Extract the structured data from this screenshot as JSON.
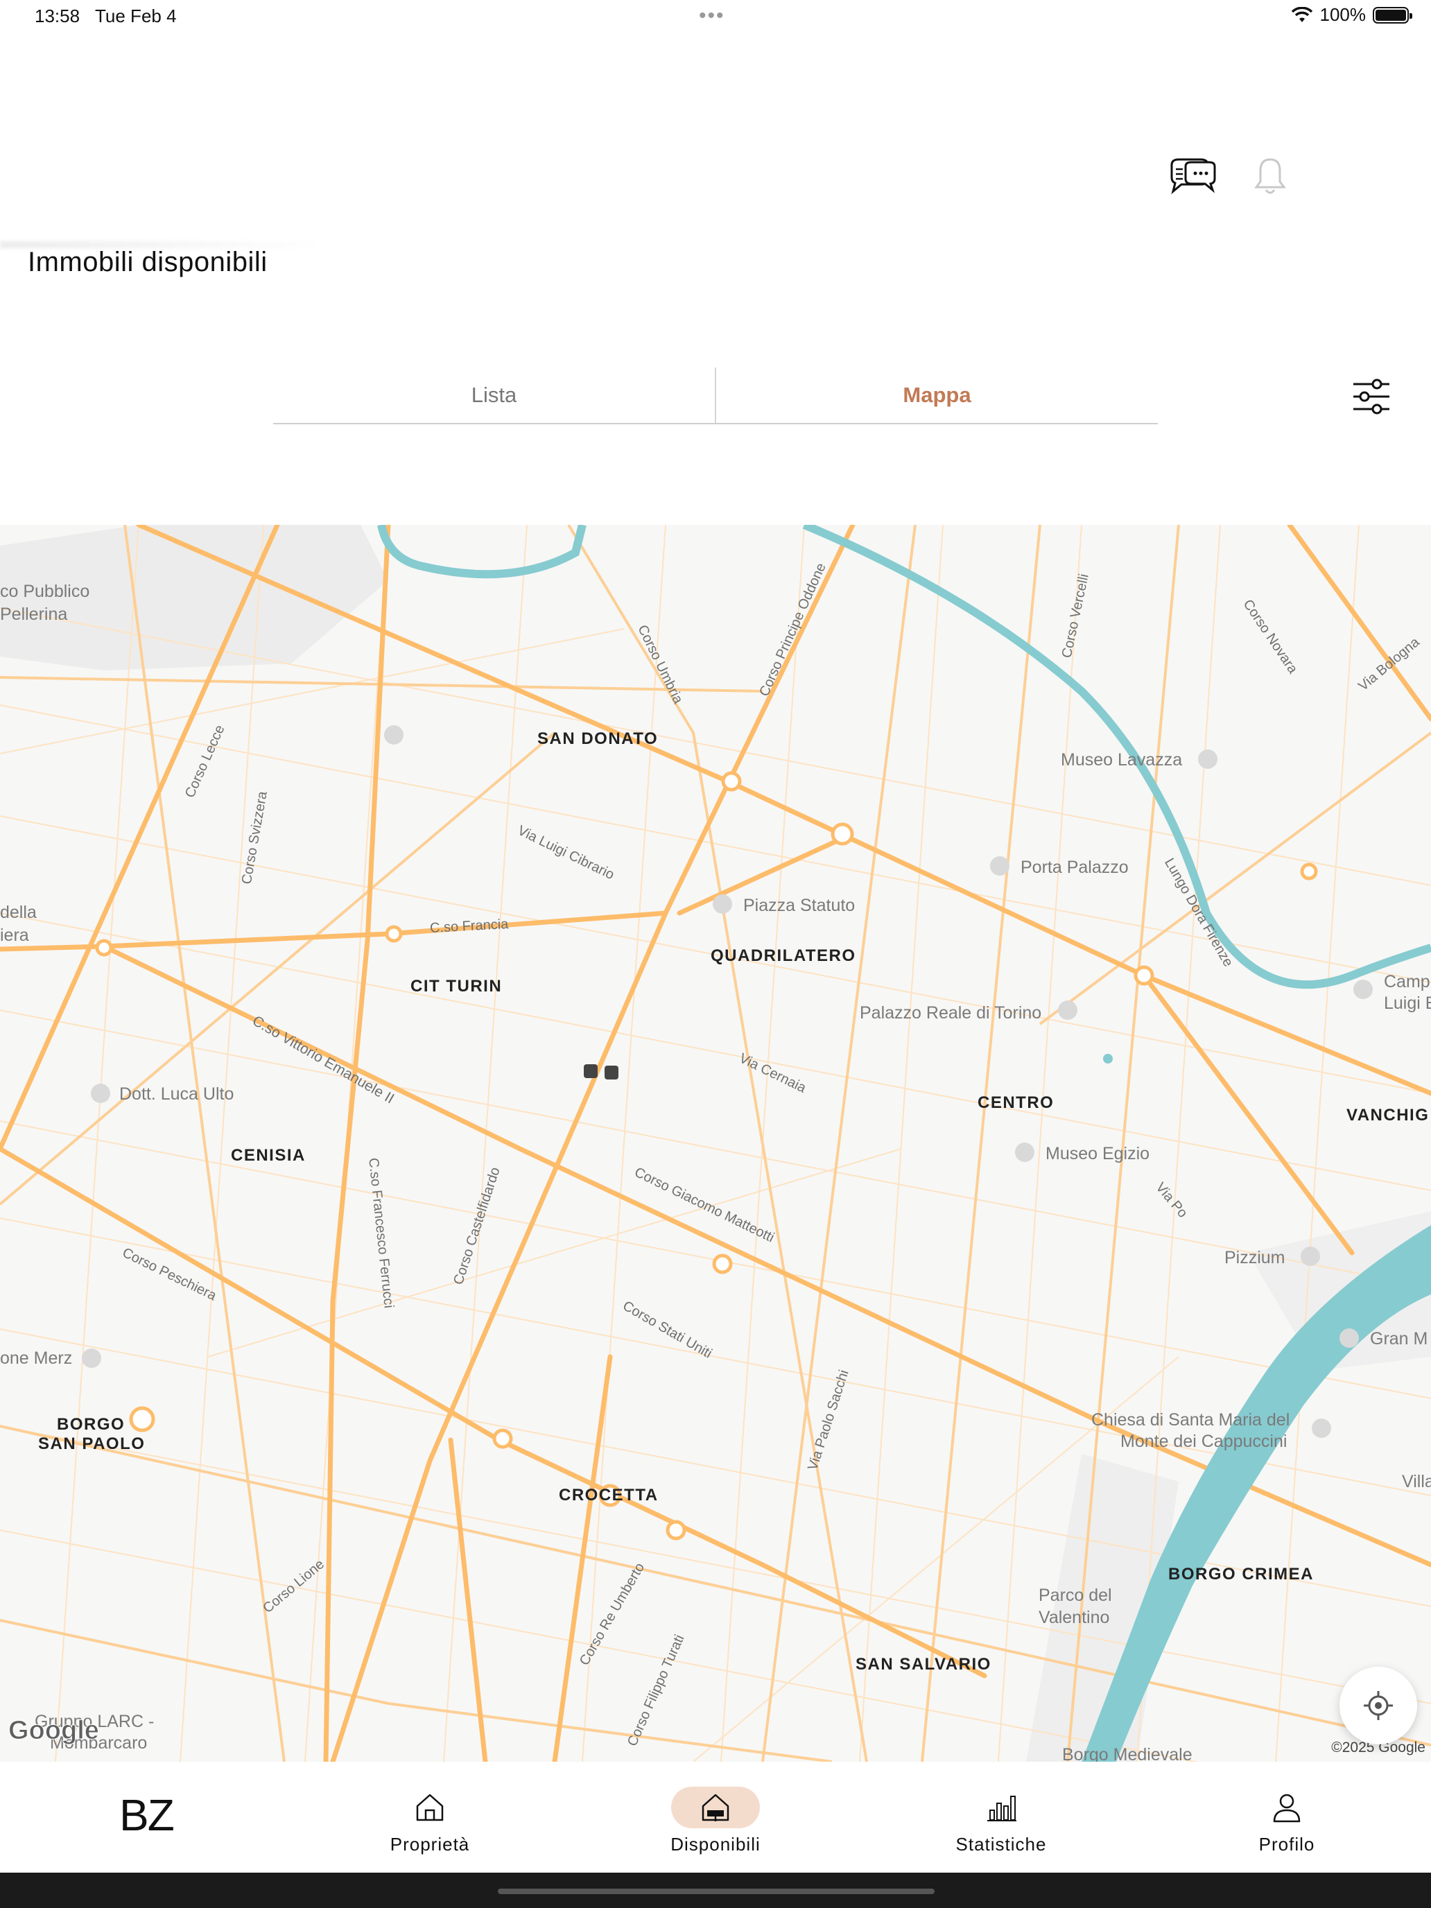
{
  "status_bar": {
    "time": "13:58",
    "date": "Tue Feb 4",
    "battery": "100%"
  },
  "header": {
    "title": "Immobili disponibili"
  },
  "segmented": {
    "lista": "Lista",
    "mappa": "Mappa",
    "selected": "Mappa"
  },
  "map": {
    "labels": {
      "san_donato": "SAN DONATO",
      "quadrilatero": "QUADRILATERO",
      "cit_turin": "CIT TURIN",
      "centro": "CENTRO",
      "vanchiglia": "VANCHIG",
      "cenisia": "CENISIA",
      "borgo_san_paolo_1": "BORGO",
      "borgo_san_paolo_2": "SAN PAOLO",
      "crocetta": "CROCETTA",
      "san_salvario": "SAN SALVARIO",
      "borgo_crimea": "BORGO CRIMEA",
      "parco_pellerina_1": "co Pubblico",
      "parco_pellerina_2": "Pellerina",
      "museo_lavazza": "Museo Lavazza",
      "porta_palazzo": "Porta Palazzo",
      "piazza_statuto": "Piazza Statuto",
      "palazzo_reale": "Palazzo Reale di Torino",
      "museo_egizio": "Museo Egizio",
      "pizzium": "Pizzium",
      "gran_madre": "Gran M",
      "campus_1": "Camp",
      "campus_2": "Luigi E",
      "chiesa_1": "Chiesa di Santa Maria del",
      "chiesa_2": "Monte dei Cappuccini",
      "villa": "Villa",
      "parco_valentino_1": "Parco del",
      "parco_valentino_2": "Valentino",
      "dott_luca": "Dott. Luca Ulto",
      "merz": "one Merz",
      "della_1": "della",
      "della_2": "iera",
      "gruppo_larc_1": "Gruppo LARC -",
      "gruppo_larc_2": "Mombarcaro",
      "borgo_medievale": "Borgo Medievale",
      "corso_lecce": "Corso Lecce",
      "corso_svizzera": "Corso Svizzera",
      "corso_umbria": "Corso Umbria",
      "corso_principe_oddone": "Corso Principe Oddone",
      "corso_vercelli": "Corso Vercelli",
      "corso_novara": "Corso Novara",
      "via_bologna": "Via Bologna",
      "via_luigi_cibrario": "Via Luigi Cibrario",
      "c_so_francia": "C.so Francia",
      "c_so_vittorio": "C.so Vittorio Emanuele II",
      "lungo_po": "Lungo Dora Firenze",
      "via_cernaia": "Via Cernaia",
      "corso_matteotti": "Corso Giacomo Matteotti",
      "via_po": "Via Po",
      "c_so_ferrucci": "C.so Francesco Ferrucci",
      "corso_peschiera": "Corso Peschiera",
      "corso_castelfidardo": "Corso Castelfidardo",
      "corso_stati_uniti": "Corso Stati Uniti",
      "via_sacchi": "Via Paolo Sacchi",
      "corso_re_umberto": "Corso Re Umberto",
      "corso_turati": "Corso Filippo Turati",
      "corso_lione": "Corso Lione",
      "google": "Google",
      "copyright": "©2025 Google"
    },
    "colors": {
      "road_major": "#fdbc6a",
      "road_minor": "#fcd9ad",
      "river": "#86cbd0",
      "park": "#ececec"
    }
  },
  "tabs": [
    {
      "label": "Proprietà",
      "icon": "house-icon"
    },
    {
      "label": "Disponibili",
      "icon": "house-new-icon",
      "active": true
    },
    {
      "label": "Statistiche",
      "icon": "bar-chart-icon"
    },
    {
      "label": "Profilo",
      "icon": "person-icon"
    }
  ],
  "logo": "BZ"
}
